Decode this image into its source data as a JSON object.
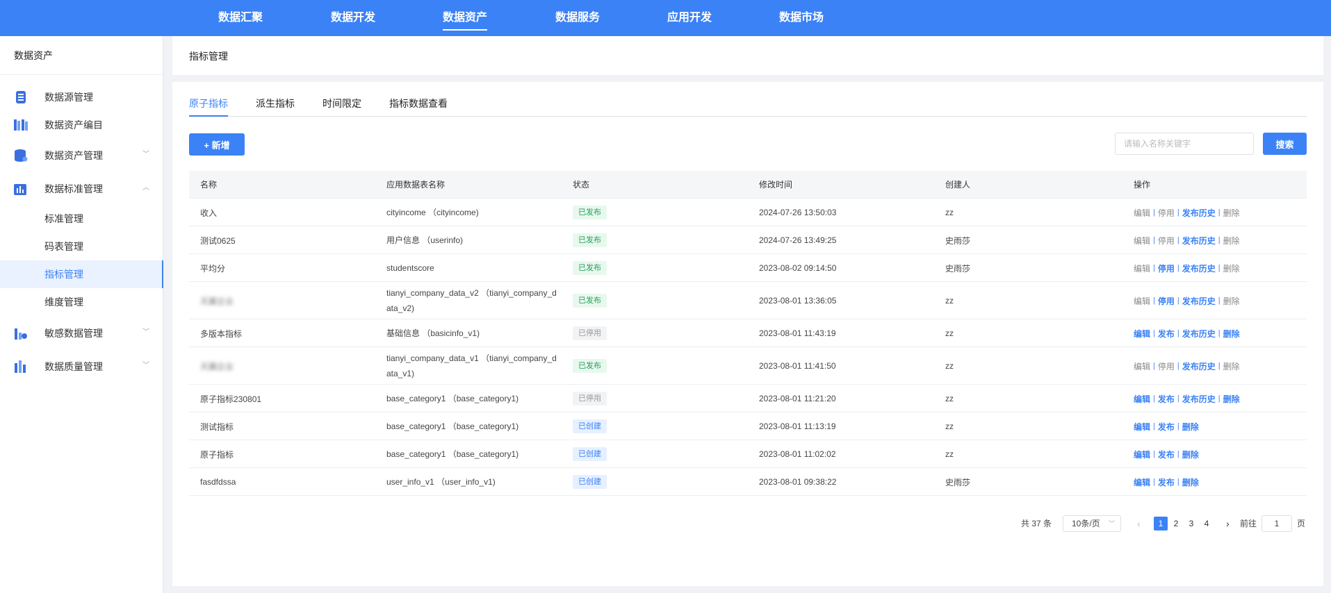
{
  "topnav": {
    "items": [
      "数据汇聚",
      "数据开发",
      "数据资产",
      "数据服务",
      "应用开发",
      "数据市场"
    ],
    "active": "数据资产"
  },
  "sidebar": {
    "title": "数据资产",
    "items": [
      {
        "label": "数据源管理",
        "icon": "database-source-icon"
      },
      {
        "label": "数据资产编目",
        "icon": "catalog-books-icon"
      },
      {
        "label": "数据资产管理",
        "icon": "database-stack-icon"
      },
      {
        "label": "数据标准管理",
        "icon": "standard-chart-icon"
      },
      {
        "label": "敏感数据管理",
        "icon": "sensitive-chart-icon"
      },
      {
        "label": "数据质量管理",
        "icon": "quality-chart-icon"
      }
    ],
    "sub_items": [
      "标准管理",
      "码表管理",
      "指标管理",
      "维度管理"
    ],
    "active_sub": "指标管理"
  },
  "breadcrumb": {
    "title": "指标管理"
  },
  "tabs": [
    "原子指标",
    "派生指标",
    "时间限定",
    "指标数据查看"
  ],
  "active_tab": "原子指标",
  "toolbar": {
    "add_label": "+ 新增",
    "search_placeholder": "请输入名称关键字",
    "search_label": "搜索"
  },
  "table": {
    "columns": [
      "名称",
      "应用数据表名称",
      "状态",
      "修改时间",
      "创建人",
      "操作"
    ],
    "rows": [
      {
        "name": "收入",
        "table": "cityincome （cityincome)",
        "status": "已发布",
        "mtime": "2024-07-26 13:50:03",
        "creator": "zz",
        "ops": [
          "编辑",
          "停用",
          "发布历史",
          "删除"
        ]
      },
      {
        "name": "测试0625",
        "table": "用户信息 （userinfo)",
        "status": "已发布",
        "mtime": "2024-07-26 13:49:25",
        "creator": "史雨莎",
        "ops": [
          "编辑",
          "停用",
          "发布历史",
          "删除"
        ]
      },
      {
        "name": "平均分",
        "table": "studentscore",
        "status": "已发布",
        "mtime": "2023-08-02 09:14:50",
        "creator": "史雨莎",
        "ops": [
          "编辑",
          "停用",
          "发布历史",
          "删除"
        ]
      },
      {
        "name": "天翼企业",
        "blurred": true,
        "table": "tianyi_company_data_v2 （tianyi_company_data_v2)",
        "status": "已发布",
        "mtime": "2023-08-01 13:36:05",
        "creator": "zz",
        "ops": [
          "编辑",
          "停用",
          "发布历史",
          "删除"
        ]
      },
      {
        "name": "多版本指标",
        "table": "基础信息 （basicinfo_v1)",
        "status": "已停用",
        "mtime": "2023-08-01 11:43:19",
        "creator": "zz",
        "ops": [
          "编辑",
          "发布",
          "发布历史",
          "删除"
        ]
      },
      {
        "name": "天翼企业",
        "blurred": true,
        "table": "tianyi_company_data_v1 （tianyi_company_data_v1)",
        "status": "已发布",
        "mtime": "2023-08-01 11:41:50",
        "creator": "zz",
        "ops": [
          "编辑",
          "停用",
          "发布历史",
          "删除"
        ]
      },
      {
        "name": "原子指标230801",
        "table": "base_category1 （base_category1)",
        "status": "已停用",
        "mtime": "2023-08-01 11:21:20",
        "creator": "zz",
        "ops": [
          "编辑",
          "发布",
          "发布历史",
          "删除"
        ]
      },
      {
        "name": "测试指标",
        "table": "base_category1 （base_category1)",
        "status": "已创建",
        "mtime": "2023-08-01 11:13:19",
        "creator": "zz",
        "ops": [
          "编辑",
          "发布",
          "删除"
        ]
      },
      {
        "name": "原子指标",
        "table": "base_category1 （base_category1)",
        "status": "已创建",
        "mtime": "2023-08-01 11:02:02",
        "creator": "zz",
        "ops": [
          "编辑",
          "发布",
          "删除"
        ]
      },
      {
        "name": "fasdfdssa",
        "table": "user_info_v1 （user_info_v1)",
        "status": "已创建",
        "mtime": "2023-08-01 09:38:22",
        "creator": "史雨莎",
        "ops": [
          "编辑",
          "发布",
          "删除"
        ]
      }
    ]
  },
  "pagination": {
    "total": "共 37 条",
    "page_size": "10条/页",
    "pages": [
      "1",
      "2",
      "3",
      "4"
    ],
    "current": "1",
    "goto_label": "前往",
    "goto_value": "1",
    "unit": "页"
  },
  "colors": {
    "primary": "#3b82f6",
    "published": "#22a05a",
    "stopped": "#999999",
    "created": "#3b82f6"
  }
}
